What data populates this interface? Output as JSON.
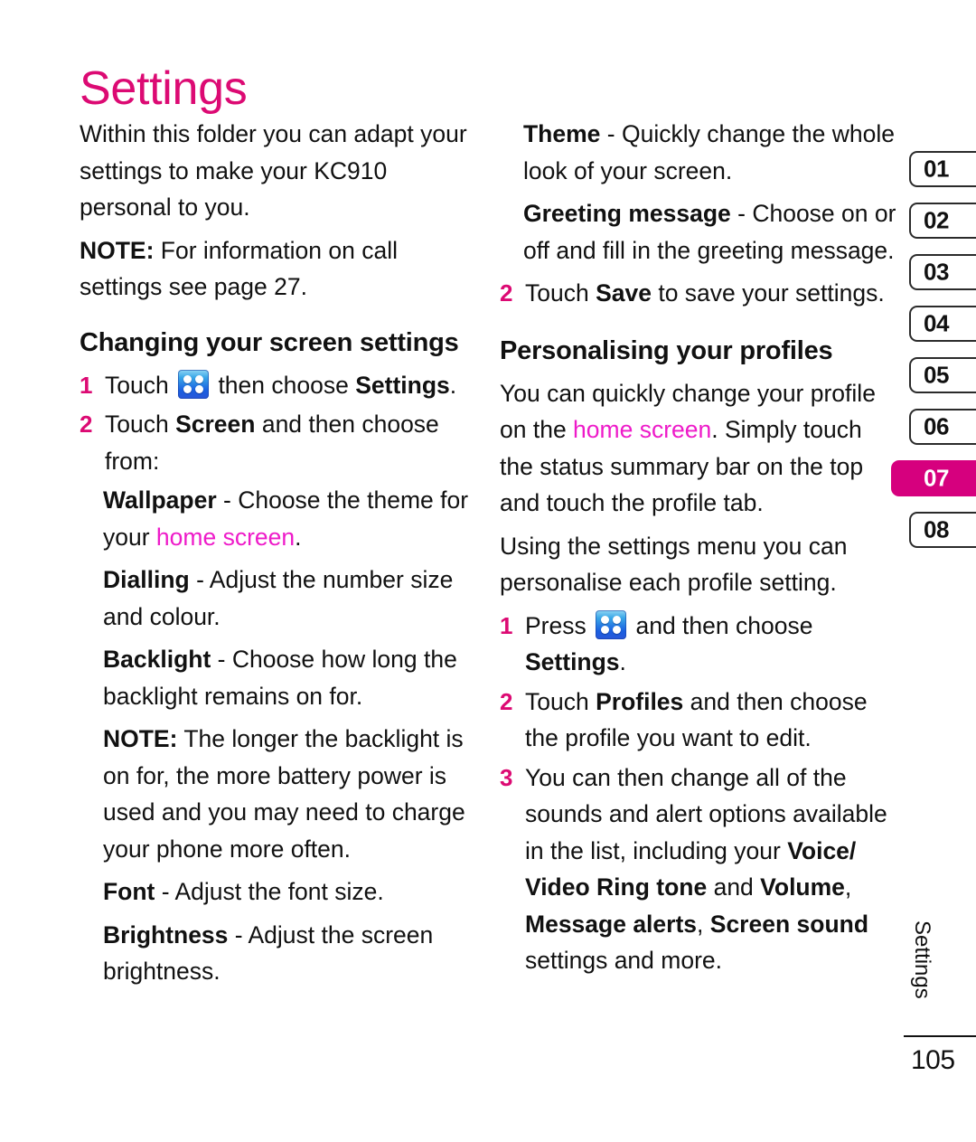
{
  "title": "Settings",
  "colors": {
    "title_pink": "#DC0A73",
    "accent_pink": "#D6007E",
    "bright_magenta": "#EE1BC9",
    "text": "#111111"
  },
  "left_column": {
    "intro": "Within this folder you can adapt your settings to make your KC910 personal to you.",
    "note_label": "NOTE:",
    "note_text": " For information on call settings see page 27.",
    "heading": "Changing your screen settings",
    "step1": {
      "number": "1",
      "text_before": "Touch ",
      "icon": "menu-grid-icon",
      "text_mid": " then choose ",
      "bold": "Settings",
      "text_after": "."
    },
    "step2": {
      "number": "2",
      "text_before": "Touch ",
      "bold": "Screen",
      "text_after": " and then choose from:"
    },
    "definitions": [
      {
        "term": "Wallpaper",
        "text_before": " - Choose the theme for your ",
        "highlight": "home screen",
        "text_after": "."
      },
      {
        "term": "Dialling",
        "text_before": " - Adjust the number size and colour.",
        "highlight": "",
        "text_after": ""
      },
      {
        "term": "Backlight",
        "text_before": " - Choose how long the backlight remains on for.",
        "highlight": "",
        "text_after": ""
      }
    ],
    "note2_label": "NOTE:",
    "note2_text": " The longer the backlight is on for, the more battery power is used and you may need to charge your phone more often.",
    "definitions2": [
      {
        "term": "Font",
        "text": " - Adjust the font size."
      },
      {
        "term": "Brightness",
        "text": " - Adjust the screen brightness."
      }
    ]
  },
  "right_column": {
    "definitions": [
      {
        "term": "Theme",
        "text": " - Quickly change the whole look of your screen."
      },
      {
        "term": "Greeting message",
        "text": " - Choose on or off and fill in the greeting message."
      }
    ],
    "step2": {
      "number": "2",
      "text_before": "Touch ",
      "bold": "Save",
      "text_after": " to save your settings."
    },
    "heading": "Personalising your profiles",
    "para1_a": "You can quickly change your profile on the ",
    "para1_highlight": "home screen",
    "para1_b": ". Simply touch the status summary bar on the top and touch the profile tab.",
    "para2": "Using the settings menu you can personalise each profile setting.",
    "step1": {
      "number": "1",
      "text_before": "Press ",
      "icon": "menu-grid-icon",
      "text_mid": " and then choose ",
      "bold": "Settings",
      "text_after": "."
    },
    "step2b": {
      "number": "2",
      "text_before": "Touch ",
      "bold": "Profiles",
      "text_after": " and then choose the profile you want to edit."
    },
    "step3": {
      "number": "3",
      "a": "You can then change all of the sounds and alert options available in the list, including your ",
      "b1": "Voice/ Video Ring tone",
      "c": " and ",
      "b2": "Volume",
      "d": ", ",
      "b3": "Message alerts",
      "e": ", ",
      "b4": "Screen sound",
      "f": " settings and more."
    }
  },
  "tabs": [
    {
      "label": "01",
      "active": false
    },
    {
      "label": "02",
      "active": false
    },
    {
      "label": "03",
      "active": false
    },
    {
      "label": "04",
      "active": false
    },
    {
      "label": "05",
      "active": false
    },
    {
      "label": "06",
      "active": false
    },
    {
      "label": "07",
      "active": true
    },
    {
      "label": "08",
      "active": false
    }
  ],
  "footer": {
    "chapter": "Settings",
    "page_number": "105"
  }
}
